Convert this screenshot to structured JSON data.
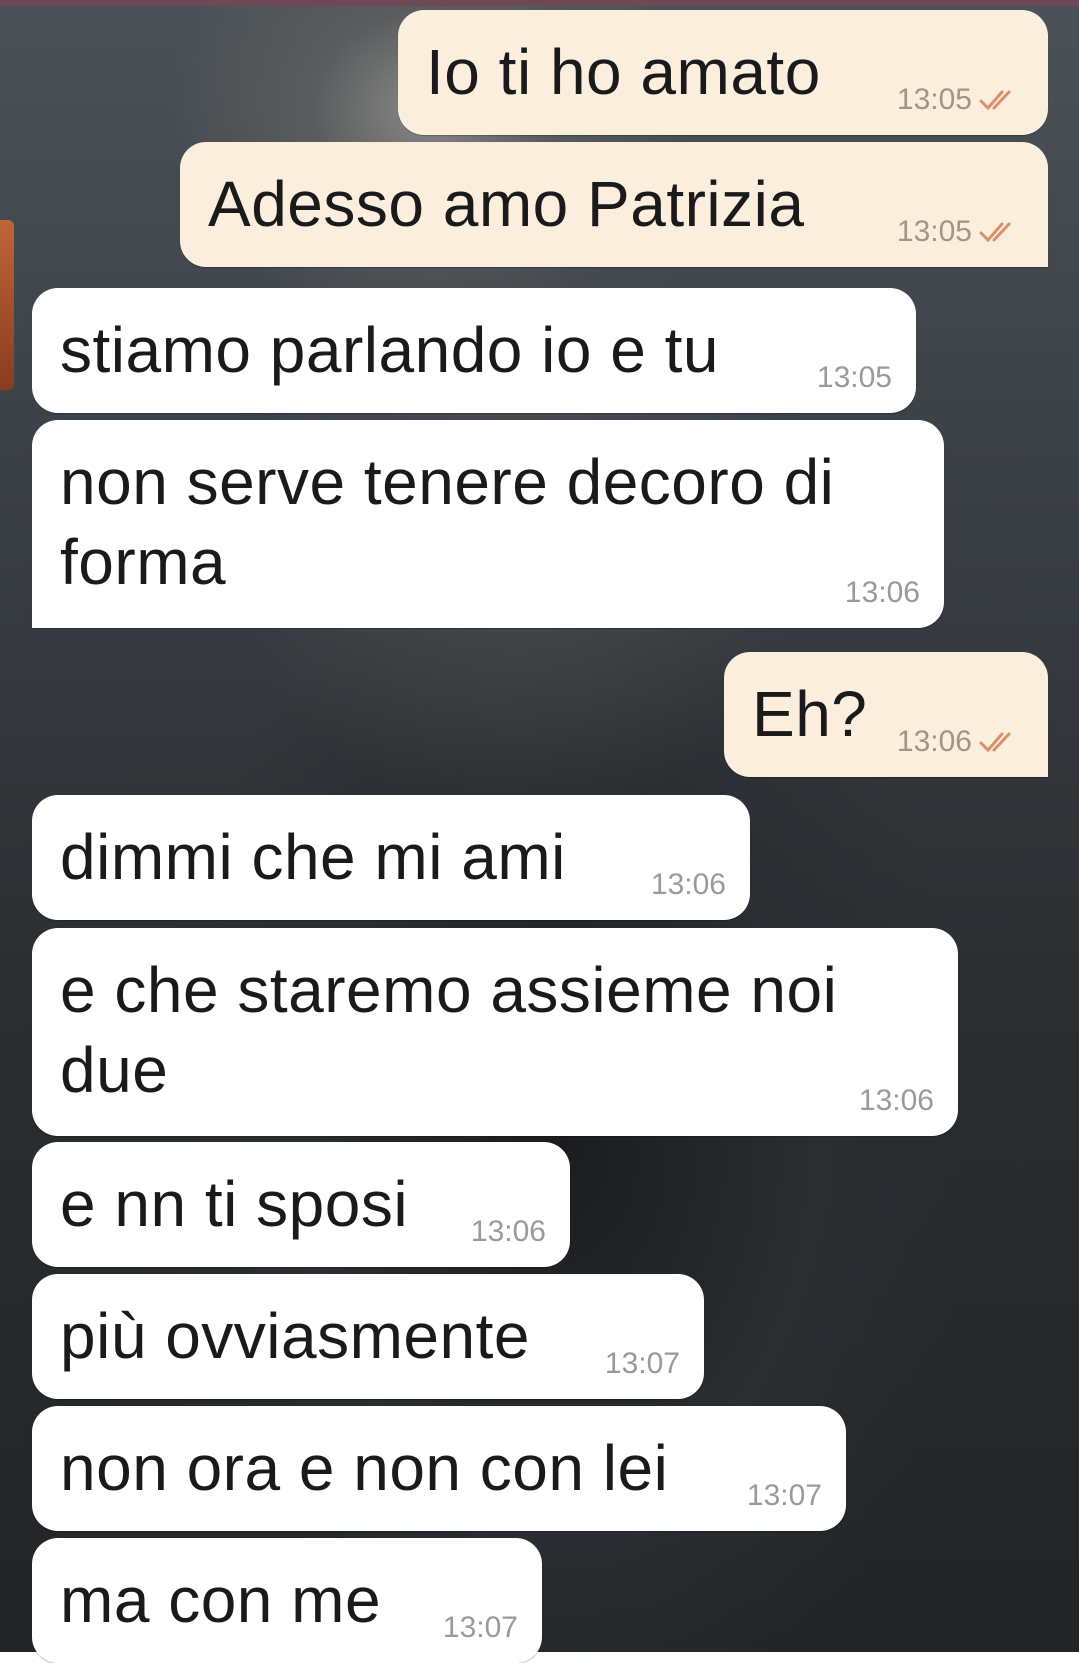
{
  "chat": {
    "messages": [
      {
        "dir": "out",
        "text": "Io ti ho amato",
        "time": "13:05",
        "status": "read"
      },
      {
        "dir": "out",
        "text": "Adesso amo Patrizia",
        "time": "13:05",
        "status": "read"
      },
      {
        "dir": "in",
        "text": "stiamo parlando io e tu",
        "time": "13:05"
      },
      {
        "dir": "in",
        "text": "non serve tenere decoro di\nforma",
        "time": "13:06"
      },
      {
        "dir": "out",
        "text": "Eh?",
        "time": "13:06",
        "status": "read"
      },
      {
        "dir": "in",
        "text": "dimmi che mi ami",
        "time": "13:06"
      },
      {
        "dir": "in",
        "text": "e che staremo assieme noi\ndue",
        "time": "13:06"
      },
      {
        "dir": "in",
        "text": "e nn ti sposi",
        "time": "13:06"
      },
      {
        "dir": "in",
        "text": "più ovviasmente",
        "time": "13:07"
      },
      {
        "dir": "in",
        "text": "non ora e non con lei",
        "time": "13:07"
      },
      {
        "dir": "in",
        "text": "ma con me",
        "time": "13:07"
      }
    ]
  },
  "colors": {
    "incoming_bubble": "#ffffff",
    "outgoing_bubble": "#fbeedd",
    "read_ticks": "#d9906a"
  }
}
